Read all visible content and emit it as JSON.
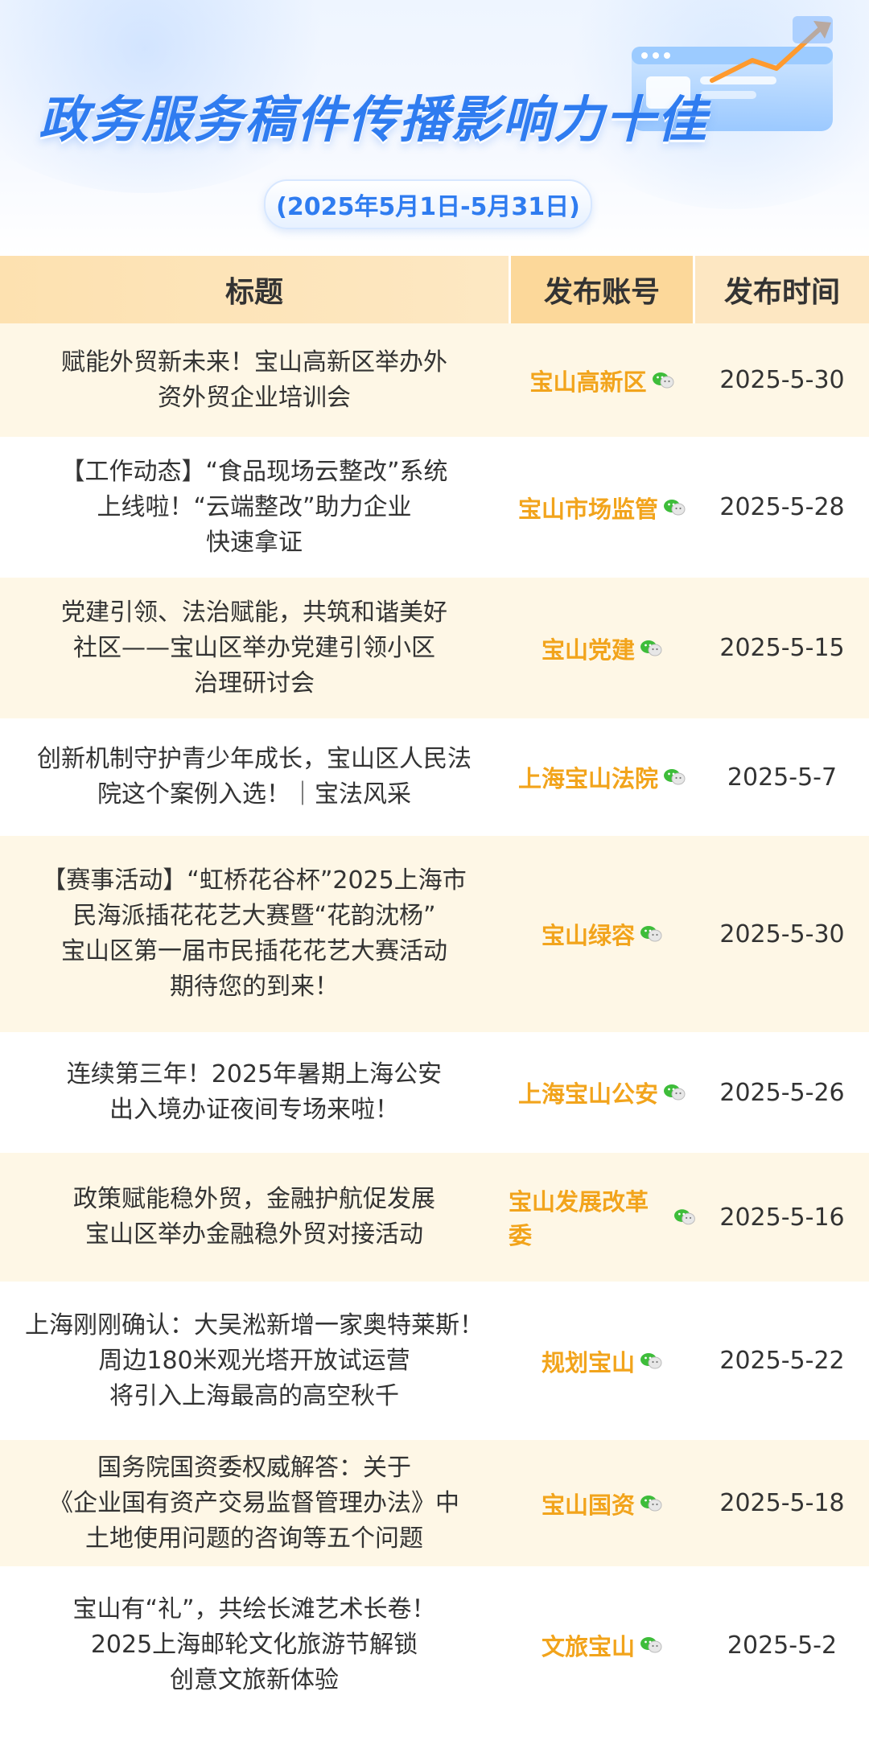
{
  "header": {
    "title": "政务服务稿件传播影响力十佳",
    "date_range": "(2025年5月1日-5月31日)"
  },
  "columns": [
    "标题",
    "发布账号",
    "发布时间"
  ],
  "colors": {
    "accent": "#2f7cf0",
    "account": "#f2a41c",
    "header_bg": "#fcd89a",
    "row_alt": "#fef7e6"
  },
  "rows": [
    {
      "title": "赋能外贸新未来！宝山高新区举办外\n资外贸企业培训会",
      "account": "宝山高新区",
      "icon": "wechat-icon",
      "date": "2025-5-30"
    },
    {
      "title": "【工作动态】“食品现场云整改”系统\n上线啦！“云端整改”助力企业\n快速拿证",
      "account": "宝山市场监管",
      "icon": "wechat-icon",
      "date": "2025-5-28"
    },
    {
      "title": "党建引领、法治赋能，共筑和谐美好\n社区——宝山区举办党建引领小区\n治理研讨会",
      "account": "宝山党建",
      "icon": "wechat-icon",
      "date": "2025-5-15"
    },
    {
      "title": "创新机制守护青少年成长，宝山区人民法\n院这个案例入选！｜宝法风采",
      "account": "上海宝山法院",
      "icon": "wechat-icon",
      "date": "2025-5-7"
    },
    {
      "title": "【赛事活动】“虹桥花谷杯”2025上海市\n民海派插花花艺大赛暨“花韵沈杨”\n宝山区第一届市民插花花艺大赛活动\n期待您的到来！",
      "account": "宝山绿容",
      "icon": "wechat-icon",
      "date": "2025-5-30"
    },
    {
      "title": "连续第三年！2025年暑期上海公安\n出入境办证夜间专场来啦！",
      "account": "上海宝山公安",
      "icon": "wechat-icon",
      "date": "2025-5-26"
    },
    {
      "title": "政策赋能稳外贸，金融护航促发展\n宝山区举办金融稳外贸对接活动",
      "account": "宝山发展改革委",
      "icon": "wechat-icon",
      "date": "2025-5-16"
    },
    {
      "title": "上海刚刚确认：大吴淞新增一家奥特莱斯！\n周边180米观光塔开放试运营\n将引入上海最高的高空秋千",
      "account": "规划宝山",
      "icon": "wechat-icon",
      "date": "2025-5-22"
    },
    {
      "title": "国务院国资委权威解答：关于\n《企业国有资产交易监督管理办法》中\n土地使用问题的咨询等五个问题",
      "account": "宝山国资",
      "icon": "wechat-icon",
      "date": "2025-5-18"
    },
    {
      "title": "宝山有“礼”，共绘长滩艺术长卷！\n2025上海邮轮文化旅游节解锁\n创意文旅新体验",
      "account": "文旅宝山",
      "icon": "wechat-icon",
      "date": "2025-5-2"
    }
  ]
}
